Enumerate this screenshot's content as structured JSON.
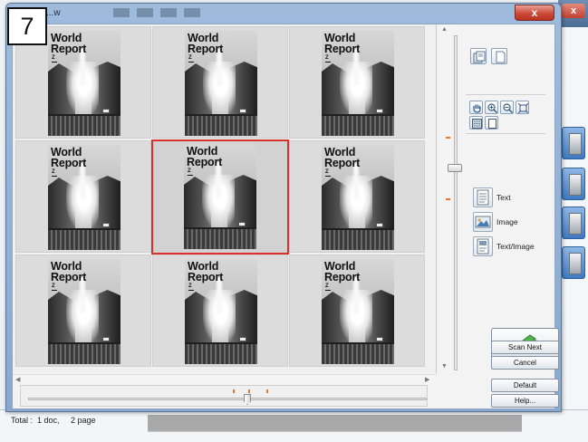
{
  "step_badge": "7",
  "window": {
    "title": "...w",
    "close_label": "x"
  },
  "thumbnails": [
    {
      "title": "World\nReport",
      "sub": "Z",
      "selected": false
    },
    {
      "title": "World\nReport",
      "sub": "Z",
      "selected": false
    },
    {
      "title": "World\nReport",
      "sub": "Z",
      "selected": false
    },
    {
      "title": "World\nReport",
      "sub": "Z",
      "selected": false
    },
    {
      "title": "World\nReport",
      "sub": "Z",
      "selected": true
    },
    {
      "title": "World\nReport",
      "sub": "Z",
      "selected": false
    },
    {
      "title": "World\nReport",
      "sub": "Z",
      "selected": false
    },
    {
      "title": "World\nReport",
      "sub": "Z",
      "selected": false
    },
    {
      "title": "World\nReport",
      "sub": "Z",
      "selected": false
    }
  ],
  "modes": {
    "text_label": "Text",
    "image_label": "Image",
    "text_image_label": "Text/Image"
  },
  "actions": {
    "scan_next": "Scan Next",
    "cancel": "Cancel",
    "default": "Default",
    "help": "Help..."
  },
  "status": {
    "total": "Total :  1 doc,     2 page"
  },
  "icons": {
    "page_view_a": "multi-page-icon",
    "page_view_b": "single-page-icon",
    "hand": "hand-tool-icon",
    "zoom_in": "zoom-in-icon",
    "zoom_out": "zoom-out-icon",
    "fit": "fit-page-icon",
    "select_all": "select-all-icon",
    "blank": "blank-page-icon",
    "scanner": "scanner-icon"
  },
  "colors": {
    "selection": "#d9302c",
    "tick": "#e7752c"
  }
}
